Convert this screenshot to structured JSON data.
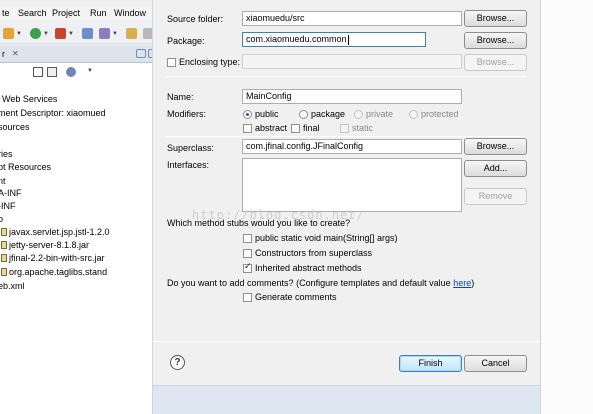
{
  "menubar": {
    "items": [
      "te",
      "Search",
      "Project",
      "Run",
      "Window"
    ]
  },
  "pane": {
    "title": "r",
    "close": "✕"
  },
  "tree": {
    "items": [
      "Web Services",
      "ment Descriptor: xiaomued",
      "sources",
      "ries",
      "pt Resources",
      "nt",
      "A-INF",
      "-INF",
      "o",
      "javax.servlet.jsp.jstl-1.2.0",
      "jetty-server-8.1.8.jar",
      "jfinal-2.2-bin-with-src.jar",
      "org.apache.taglibs.stand",
      "eb.xml"
    ]
  },
  "dialog": {
    "source_folder": {
      "label": "Source folder:",
      "value": "xiaomuedu/src",
      "button": "Browse..."
    },
    "package": {
      "label": "Package:",
      "value": "com.xiaomuedu.common",
      "button": "Browse..."
    },
    "enclosing": {
      "label": "Enclosing type:",
      "value": "",
      "button": "Browse..."
    },
    "name": {
      "label": "Name:",
      "value": "MainConfig"
    },
    "modifiers": {
      "label": "Modifiers:",
      "public": "public",
      "package": "package",
      "private": "private",
      "protected": "protected",
      "abstract": "abstract",
      "final": "final",
      "static": "static"
    },
    "superclass": {
      "label": "Superclass:",
      "value": "com.jfinal.config.JFinalConfig",
      "button": "Browse..."
    },
    "interfaces": {
      "label": "Interfaces:",
      "add": "Add...",
      "remove": "Remove"
    },
    "stubs": {
      "question": "Which method stubs would you like to create?",
      "main": "public static void main(String[] args)",
      "constructors": "Constructors from superclass",
      "inherited": "Inherited abstract methods"
    },
    "comments": {
      "question": "Do you want to add comments? (Configure templates and default value",
      "link": "here",
      "tail": ")",
      "generate": "Generate comments"
    },
    "help": "?",
    "finish": "Finish",
    "cancel": "Cancel"
  },
  "watermark": "http://blog.csdn.net/"
}
